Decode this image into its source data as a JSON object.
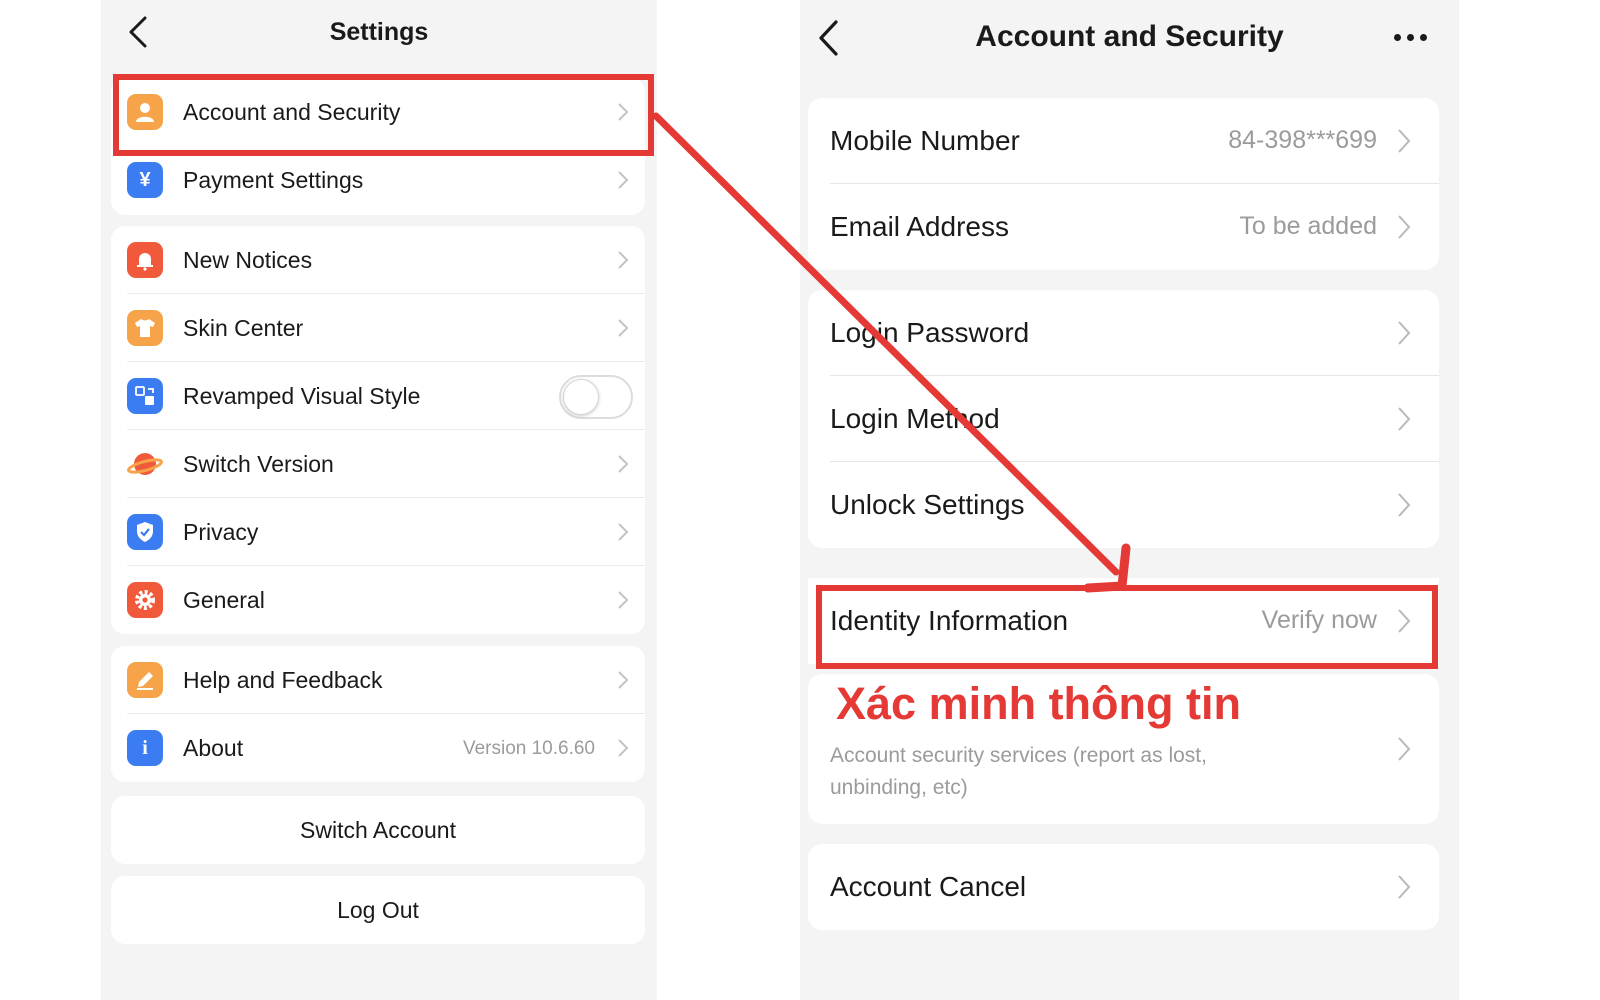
{
  "left": {
    "title": "Settings",
    "group1": [
      {
        "label": "Account and Security",
        "icon": "user-icon",
        "color": "#f7a34a"
      },
      {
        "label": "Payment Settings",
        "icon": "yuan-icon",
        "color": "#3b7cf2"
      }
    ],
    "group2": [
      {
        "label": "New Notices",
        "icon": "bell-icon",
        "color": "#f05a3a"
      },
      {
        "label": "Skin Center",
        "icon": "shirt-icon",
        "color": "#f7a34a"
      },
      {
        "label": "Revamped Visual Style",
        "icon": "style-icon",
        "color": "#3b7cf2",
        "toggle": false
      },
      {
        "label": "Switch Version",
        "icon": "planet-icon",
        "color": "#f05a3a"
      },
      {
        "label": "Privacy",
        "icon": "shield-icon",
        "color": "#3b7cf2"
      },
      {
        "label": "General",
        "icon": "gear-icon",
        "color": "#f05a3a"
      }
    ],
    "group3": [
      {
        "label": "Help and Feedback",
        "icon": "pencil-icon",
        "color": "#f7a34a"
      },
      {
        "label": "About",
        "icon": "info-icon",
        "color": "#3b7cf2",
        "value": "Version 10.6.60"
      }
    ],
    "switch_account": "Switch Account",
    "log_out": "Log Out"
  },
  "right": {
    "title": "Account and Security",
    "group1": [
      {
        "label": "Mobile Number",
        "value": "84-398***699"
      },
      {
        "label": "Email Address",
        "value": "To be added"
      }
    ],
    "group2": [
      {
        "label": "Login Password"
      },
      {
        "label": "Login Method"
      },
      {
        "label": "Unlock Settings"
      }
    ],
    "identity": {
      "label": "Identity Information",
      "value": "Verify now"
    },
    "annotation": "Xác minh thông tin",
    "security_desc": "Account security services (report as lost, unbinding, etc)",
    "account_cancel": "Account Cancel"
  },
  "colors": {
    "highlight": "#e53935",
    "chevron": "#c4c4c4"
  }
}
